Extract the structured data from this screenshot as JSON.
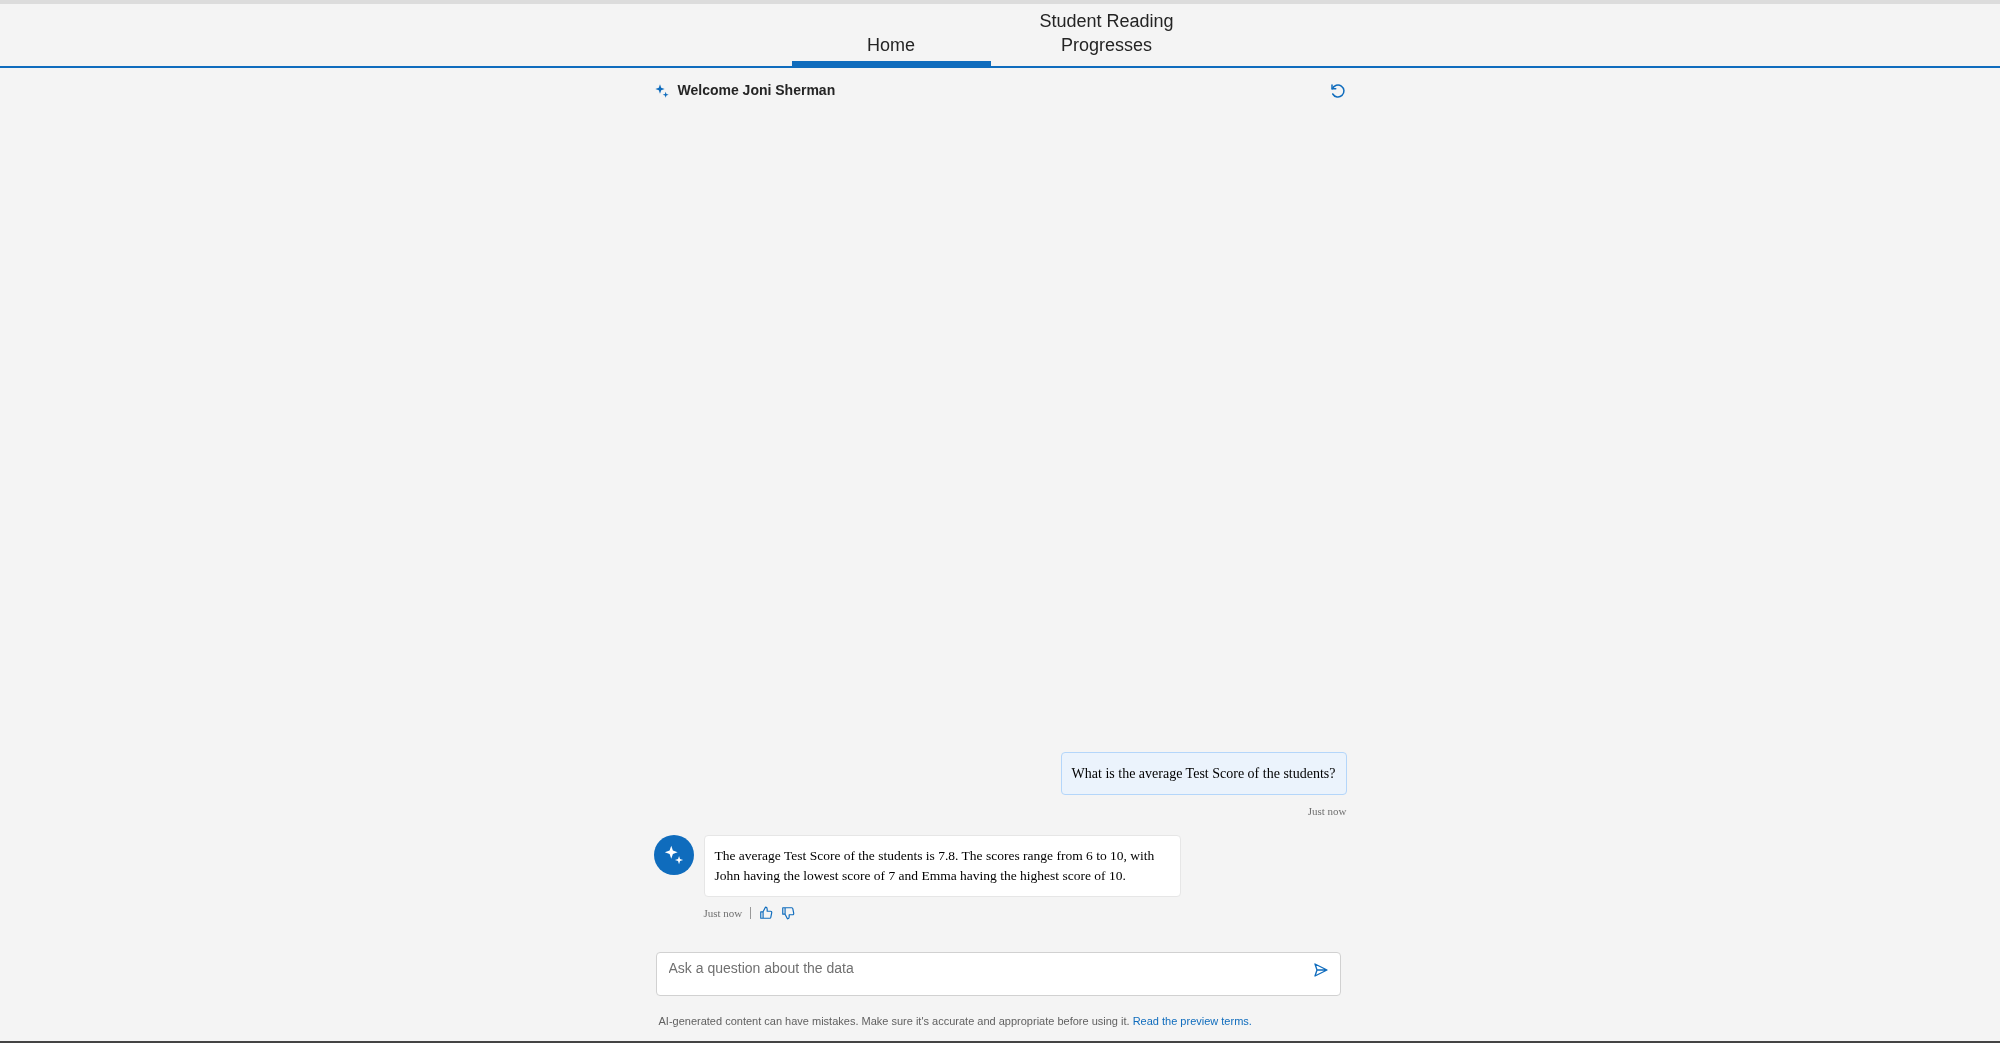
{
  "tabs": [
    {
      "label": "Home",
      "selected": true
    },
    {
      "label": "Student Reading Progresses",
      "selected": false
    }
  ],
  "header": {
    "welcome": "Welcome Joni Sherman"
  },
  "messages": [
    {
      "kind": "user",
      "text": "What is the average Test Score of the students?",
      "time": "Just now"
    },
    {
      "kind": "bot",
      "text": "The average Test Score of the students is 7.8. The scores range from 6 to 10, with John having the lowest score of 7 and Emma having the highest score of 10.",
      "time": "Just now"
    }
  ],
  "input": {
    "placeholder": "Ask a question about the data"
  },
  "footer": {
    "text": "AI-generated content can have mistakes. Make sure it's accurate and appropriate before using it.",
    "link": "Read the preview terms."
  }
}
